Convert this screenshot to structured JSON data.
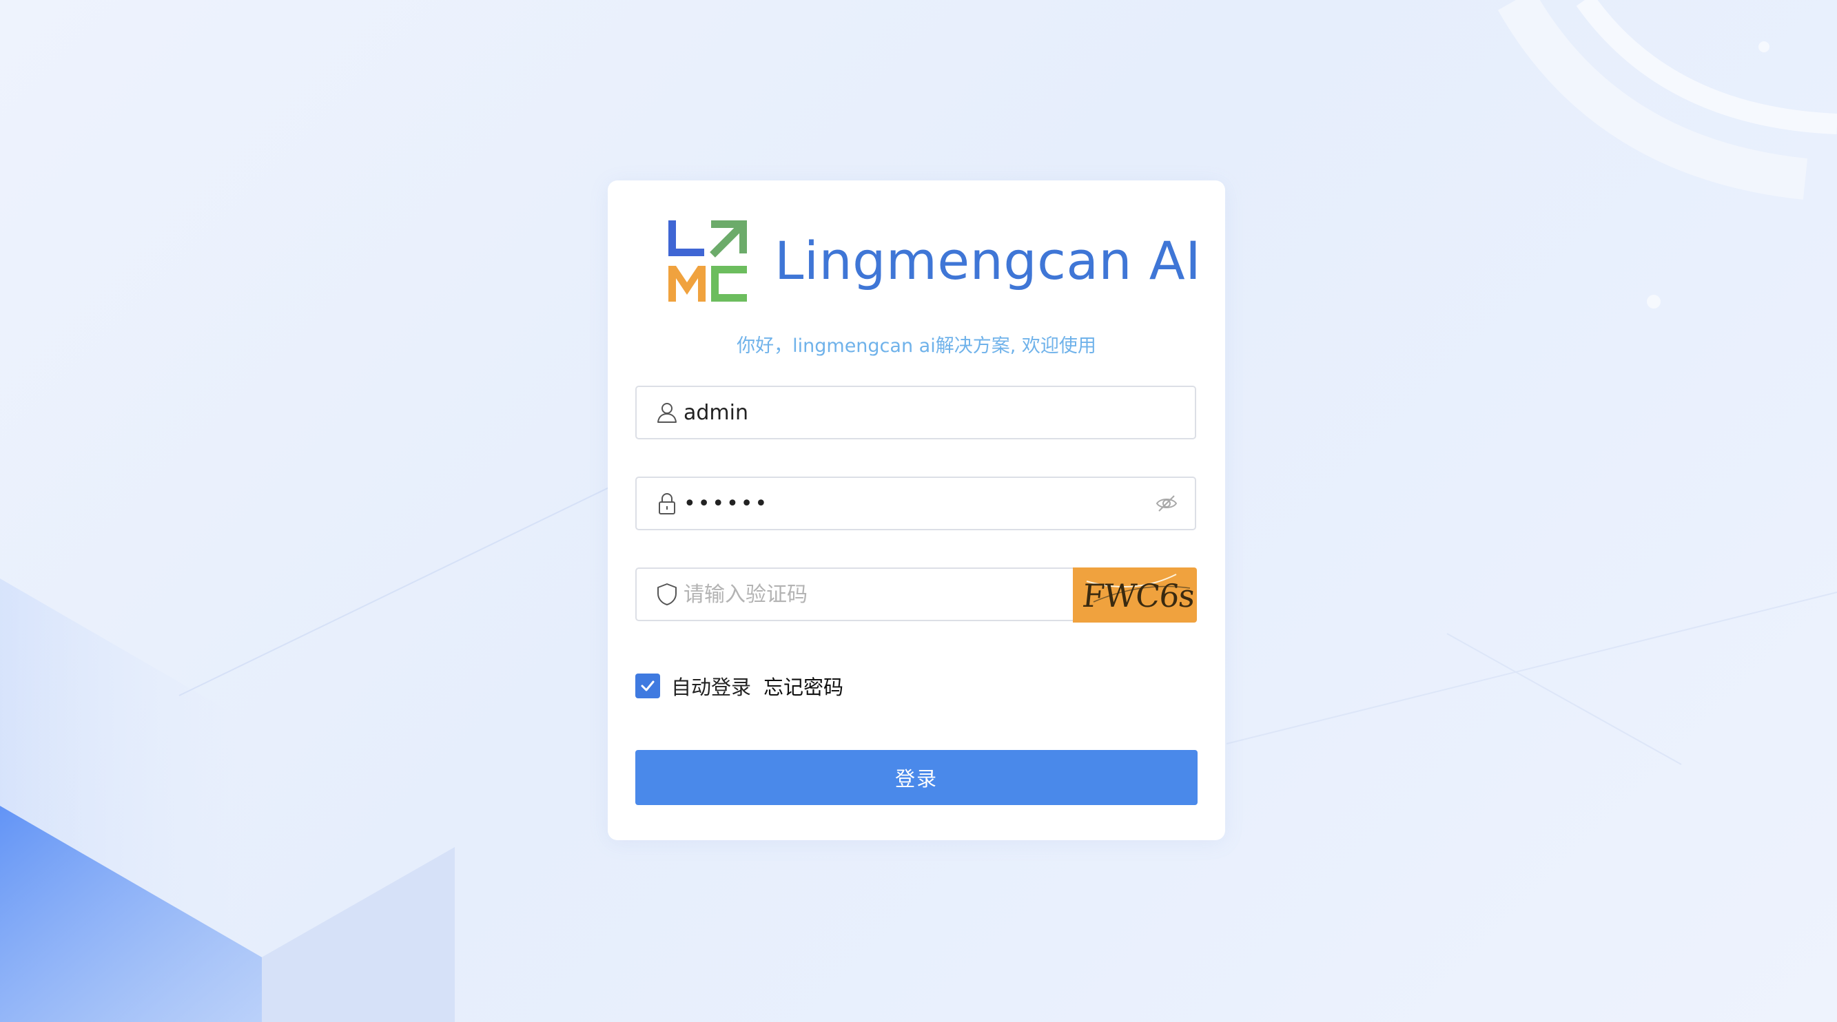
{
  "brand": {
    "name": "Lingmengcan AI",
    "logo_letters": "LMC"
  },
  "subtitle": "你好，lingmengcan ai解决方案, 欢迎使用",
  "form": {
    "username_value": "admin",
    "password_value": "••••••",
    "captcha_placeholder": "请输入验证码",
    "captcha_code": "FWC6s",
    "remember_label": "自动登录",
    "remember_checked": true,
    "forgot_label": "忘记密码",
    "login_label": "登录"
  },
  "colors": {
    "brand_blue": "#3f76d6",
    "subtitle_blue": "#6fb2ea",
    "button_blue": "#4a89ea",
    "captcha_bg": "#f0a23e"
  },
  "icons": {
    "username": "user-icon",
    "password": "lock-icon",
    "captcha": "shield-icon",
    "toggle_password": "eye-off-icon",
    "checkbox": "check-icon"
  }
}
